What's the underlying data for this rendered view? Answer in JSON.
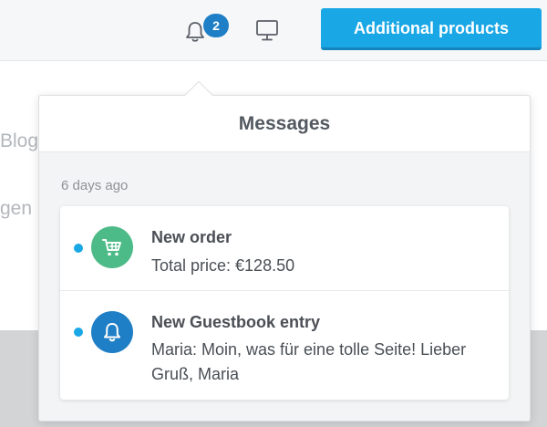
{
  "header": {
    "notification_count": "2",
    "cta_label": "Additional products"
  },
  "background": {
    "blog_fragment": "Blog",
    "gen_fragment": "gen"
  },
  "messages_panel": {
    "title": "Messages",
    "date_label": "6 days ago",
    "items": [
      {
        "title": "New order",
        "body": "Total price: €128.50",
        "icon": "cart-icon",
        "unread": true,
        "color": "#4dbb87"
      },
      {
        "title": "New Guestbook entry",
        "body": "Maria: Moin, was für eine tolle Seite! Lieber Gruß, Maria",
        "icon": "bell-icon",
        "unread": true,
        "color": "#1f7fc6"
      }
    ]
  },
  "colors": {
    "accent": "#1aa7e6",
    "badge": "#1f7fc6",
    "order_green": "#4dbb87"
  }
}
